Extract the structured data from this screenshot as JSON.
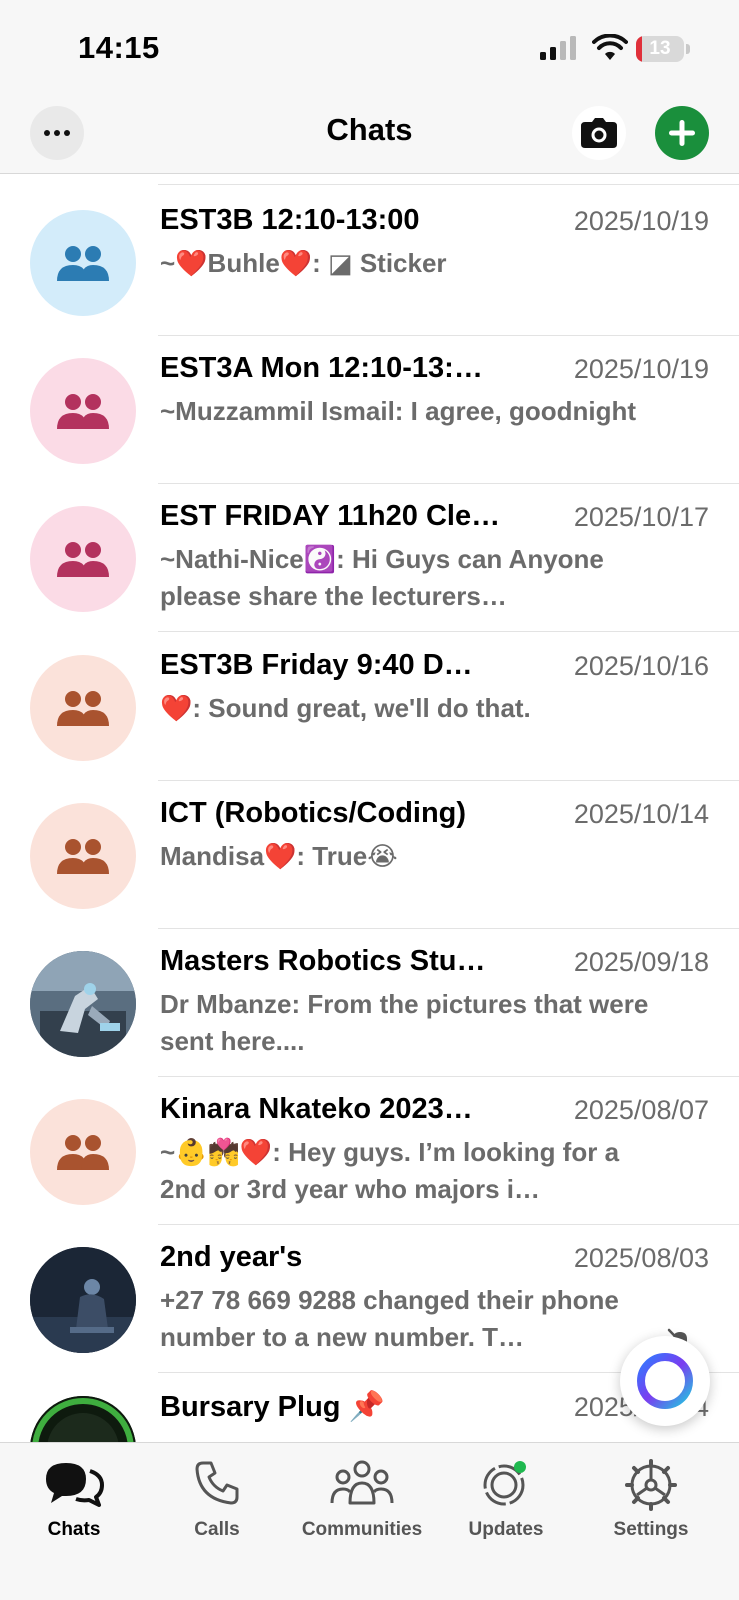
{
  "status_bar": {
    "time": "14:15",
    "battery_level": "13",
    "battery_fraction": 0.13
  },
  "header": {
    "title": "Chats",
    "more_icon": "ellipsis-icon",
    "camera_icon": "camera-icon",
    "new_chat_icon": "plus-icon"
  },
  "chats": [
    {
      "name": "EST3B 12:10-13:00",
      "date": "2025/10/19",
      "preview": "~❤️Buhle❤️: ◪ Sticker",
      "avatar_type": "group",
      "avatar_bg": "#d3ecfa",
      "avatar_fg": "#2c7cb3"
    },
    {
      "name": "EST3A Mon 12:10-13:…",
      "date": "2025/10/19",
      "preview": "~Muzzammil Ismail: I agree, goodnight",
      "avatar_type": "group",
      "avatar_bg": "#fbdbe6",
      "avatar_fg": "#b3325e"
    },
    {
      "name": "EST FRIDAY 11h20 Cle…",
      "date": "2025/10/17",
      "preview": "~Nathi-Nice☯️: Hi Guys can Anyone please share the lecturers…",
      "avatar_type": "group",
      "avatar_bg": "#fbdbe6",
      "avatar_fg": "#b3325e"
    },
    {
      "name": "EST3B Friday 9:40  D…",
      "date": "2025/10/16",
      "preview": "❤️: Sound great, we'll do that.",
      "avatar_type": "group",
      "avatar_bg": "#fbe2da",
      "avatar_fg": "#a9532f"
    },
    {
      "name": "ICT (Robotics/Coding)",
      "date": "2025/10/14",
      "preview": "Mandisa❤️: True😭",
      "avatar_type": "group",
      "avatar_bg": "#fbe2da",
      "avatar_fg": "#a9532f"
    },
    {
      "name": "Masters Robotics Stu…",
      "date": "2025/09/18",
      "preview": "Dr Mbanze: From the pictures that were sent here....",
      "avatar_type": "photo-robot",
      "avatar_bg": "#5a6e80",
      "avatar_fg": "#9fd3ea"
    },
    {
      "name": "Kinara Nkateko 2023…",
      "date": "2025/08/07",
      "preview": "~👶💏❤️: Hey guys. I’m looking for a 2nd or 3rd year who majors i…",
      "avatar_type": "group",
      "avatar_bg": "#fbe2da",
      "avatar_fg": "#a9532f"
    },
    {
      "name": "2nd year's",
      "date": "2025/08/03",
      "preview": "+27 78 669 9288 changed their phone number to a new number. T…",
      "avatar_type": "photo-night",
      "avatar_bg": "#1b2636",
      "avatar_fg": "#6c86a6",
      "muted": true
    },
    {
      "name": "Bursary Plug 📌",
      "date": "2025/07/24",
      "preview": "",
      "avatar_type": "photo-badge",
      "avatar_bg": "#0e1a0e",
      "avatar_fg": "#3fae3f"
    }
  ],
  "tabs": [
    {
      "label": "Chats",
      "icon": "chats-icon",
      "active": true
    },
    {
      "label": "Calls",
      "icon": "phone-icon",
      "active": false
    },
    {
      "label": "Communities",
      "icon": "communities-icon",
      "active": false
    },
    {
      "label": "Updates",
      "icon": "updates-icon",
      "active": false
    },
    {
      "label": "Settings",
      "icon": "settings-icon",
      "active": false
    }
  ],
  "colors": {
    "accent_green": "#1a8f3c",
    "header_bg": "#f7f7f7",
    "secondary_text": "#6b6b6b"
  }
}
